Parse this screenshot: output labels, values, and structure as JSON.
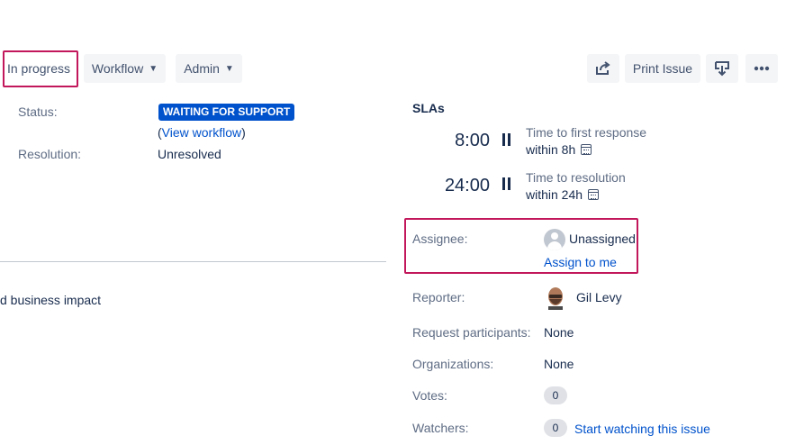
{
  "toolbar": {
    "in_progress": "In progress",
    "workflow": "Workflow",
    "admin": "Admin",
    "print_issue": "Print Issue"
  },
  "details": {
    "status_label": "Status:",
    "status_value": "WAITING FOR SUPPORT",
    "view_workflow_open": "(",
    "view_workflow": "View workflow",
    "view_workflow_close": ")",
    "resolution_label": "Resolution:",
    "resolution_value": "Unresolved",
    "description_fragment": "d business impact"
  },
  "slas": {
    "title": "SLAs",
    "items": [
      {
        "time": "8:00",
        "goal": "Time to first response",
        "within": "within 8h"
      },
      {
        "time": "24:00",
        "goal": "Time to resolution",
        "within": "within 24h"
      }
    ]
  },
  "people": {
    "assignee_label": "Assignee:",
    "assignee_value": "Unassigned",
    "assign_to_me": "Assign to me",
    "reporter_label": "Reporter:",
    "reporter_value": "Gil Levy",
    "participants_label": "Request participants:",
    "participants_value": "None",
    "organizations_label": "Organizations:",
    "organizations_value": "None",
    "votes_label": "Votes:",
    "votes_count": "0",
    "watchers_label": "Watchers:",
    "watchers_count": "0",
    "start_watching": "Start watching this issue"
  },
  "colors": {
    "accent": "#0052cc",
    "highlight": "#c2185b",
    "label": "#5e6c84"
  }
}
